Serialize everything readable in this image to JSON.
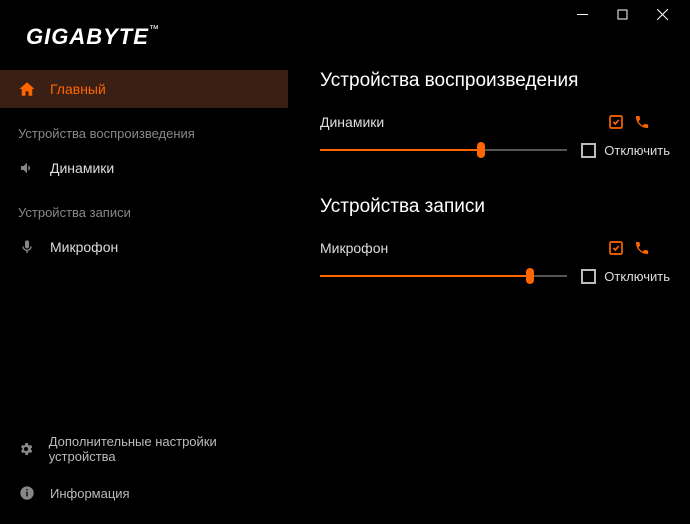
{
  "brand": "GIGABYTE",
  "nav": {
    "home": "Главный"
  },
  "sidebar": {
    "playback_header": "Устройства воспроизведения",
    "speakers": "Динамики",
    "recording_header": "Устройства записи",
    "microphone": "Микрофон",
    "advanced": "Дополнительные настройки устройства",
    "info": "Информация"
  },
  "main": {
    "playback": {
      "title": "Устройства воспроизведения",
      "device": "Динамики",
      "mute": "Отключить",
      "volume": 65
    },
    "recording": {
      "title": "Устройства записи",
      "device": "Микрофон",
      "mute": "Отключить",
      "volume": 85
    }
  },
  "colors": {
    "accent": "#ff6600",
    "bg": "#000000"
  }
}
